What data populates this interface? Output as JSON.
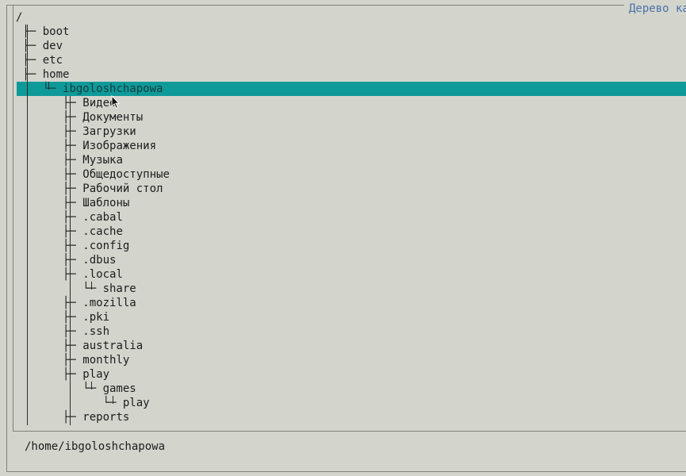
{
  "window": {
    "title": "Дерево ка"
  },
  "tree": {
    "root": "/",
    "items": [
      {
        "prefix": "├─ ",
        "indent": 1,
        "label": "boot"
      },
      {
        "prefix": "├─ ",
        "indent": 1,
        "label": "dev"
      },
      {
        "prefix": "├─ ",
        "indent": 1,
        "label": "etc"
      },
      {
        "prefix": "├─ ",
        "indent": 1,
        "label": "home"
      },
      {
        "prefix": "└─ ",
        "indent": 2,
        "label": "ibgoloshchapowa",
        "selected": true
      },
      {
        "prefix": "├─ ",
        "indent": 3,
        "label": "Видео"
      },
      {
        "prefix": "├─ ",
        "indent": 3,
        "label": "Документы"
      },
      {
        "prefix": "├─ ",
        "indent": 3,
        "label": "Загрузки"
      },
      {
        "prefix": "├─ ",
        "indent": 3,
        "label": "Изображения"
      },
      {
        "prefix": "├─ ",
        "indent": 3,
        "label": "Музыка"
      },
      {
        "prefix": "├─ ",
        "indent": 3,
        "label": "Общедоступные"
      },
      {
        "prefix": "├─ ",
        "indent": 3,
        "label": "Рабочий стол"
      },
      {
        "prefix": "├─ ",
        "indent": 3,
        "label": "Шаблоны"
      },
      {
        "prefix": "├─ ",
        "indent": 3,
        "label": ".cabal"
      },
      {
        "prefix": "├─ ",
        "indent": 3,
        "label": ".cache"
      },
      {
        "prefix": "├─ ",
        "indent": 3,
        "label": ".config"
      },
      {
        "prefix": "├─ ",
        "indent": 3,
        "label": ".dbus"
      },
      {
        "prefix": "├─ ",
        "indent": 3,
        "label": ".local"
      },
      {
        "prefix": "└─ ",
        "indent": 4,
        "label": "share"
      },
      {
        "prefix": "├─ ",
        "indent": 3,
        "label": ".mozilla"
      },
      {
        "prefix": "├─ ",
        "indent": 3,
        "label": ".pki"
      },
      {
        "prefix": "├─ ",
        "indent": 3,
        "label": ".ssh"
      },
      {
        "prefix": "├─ ",
        "indent": 3,
        "label": "australia"
      },
      {
        "prefix": "├─ ",
        "indent": 3,
        "label": "monthly"
      },
      {
        "prefix": "├─ ",
        "indent": 3,
        "label": "play"
      },
      {
        "prefix": "└─ ",
        "indent": 4,
        "label": "games"
      },
      {
        "prefix": "└─ ",
        "indent": 5,
        "label": "play"
      },
      {
        "prefix": "├─ ",
        "indent": 3,
        "label": "reports"
      }
    ]
  },
  "status": {
    "path": "/home/ibgoloshchapowa"
  }
}
